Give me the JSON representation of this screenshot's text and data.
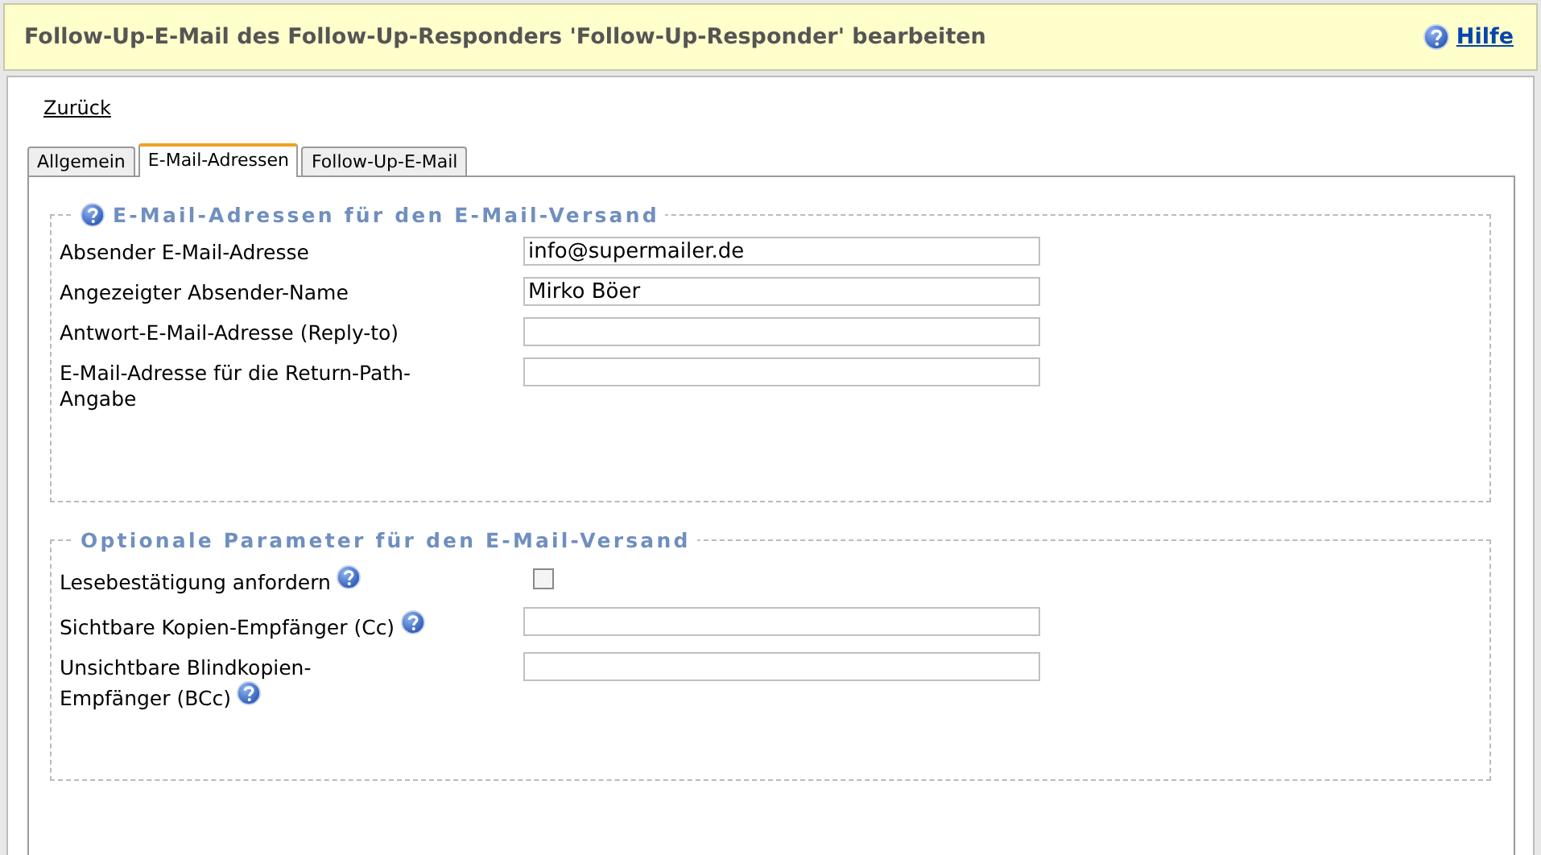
{
  "header": {
    "title": "Follow-Up-E-Mail des Follow-Up-Responders 'Follow-Up-Responder' bearbeiten",
    "help_link": "Hilfe"
  },
  "back_link": "Zurück",
  "tabs": [
    {
      "label": "Allgemein",
      "selected": false
    },
    {
      "label": "E-Mail-Adressen",
      "selected": true
    },
    {
      "label": "Follow-Up-E-Mail",
      "selected": false
    }
  ],
  "sections": [
    {
      "legend": "E-Mail-Adressen für den E-Mail-Versand",
      "help": true,
      "fields": [
        {
          "kind": "text",
          "label": "Absender E-Mail-Adresse",
          "help": false,
          "value": "info@supermailer.de"
        },
        {
          "kind": "text",
          "label": "Angezeigter Absender-Name",
          "help": false,
          "value": "Mirko Böer"
        },
        {
          "kind": "text",
          "label": "Antwort-E-Mail-Adresse (Reply-to)",
          "help": false
        },
        {
          "kind": "text",
          "label": "E-Mail-Adresse für die Return-Path-Angabe",
          "help": false
        }
      ]
    },
    {
      "legend": "Optionale Parameter für den E-Mail-Versand",
      "help": false,
      "fields": [
        {
          "kind": "checkbox",
          "label": "Lesebestätigung anfordern",
          "help": true,
          "checked": false
        },
        {
          "kind": "text",
          "label": "Sichtbare Kopien-Empfänger (Cc)",
          "help": true
        },
        {
          "kind": "text",
          "label": "Unsichtbare Blindkopien-Empfänger (BCc)",
          "help": true
        }
      ]
    }
  ]
}
